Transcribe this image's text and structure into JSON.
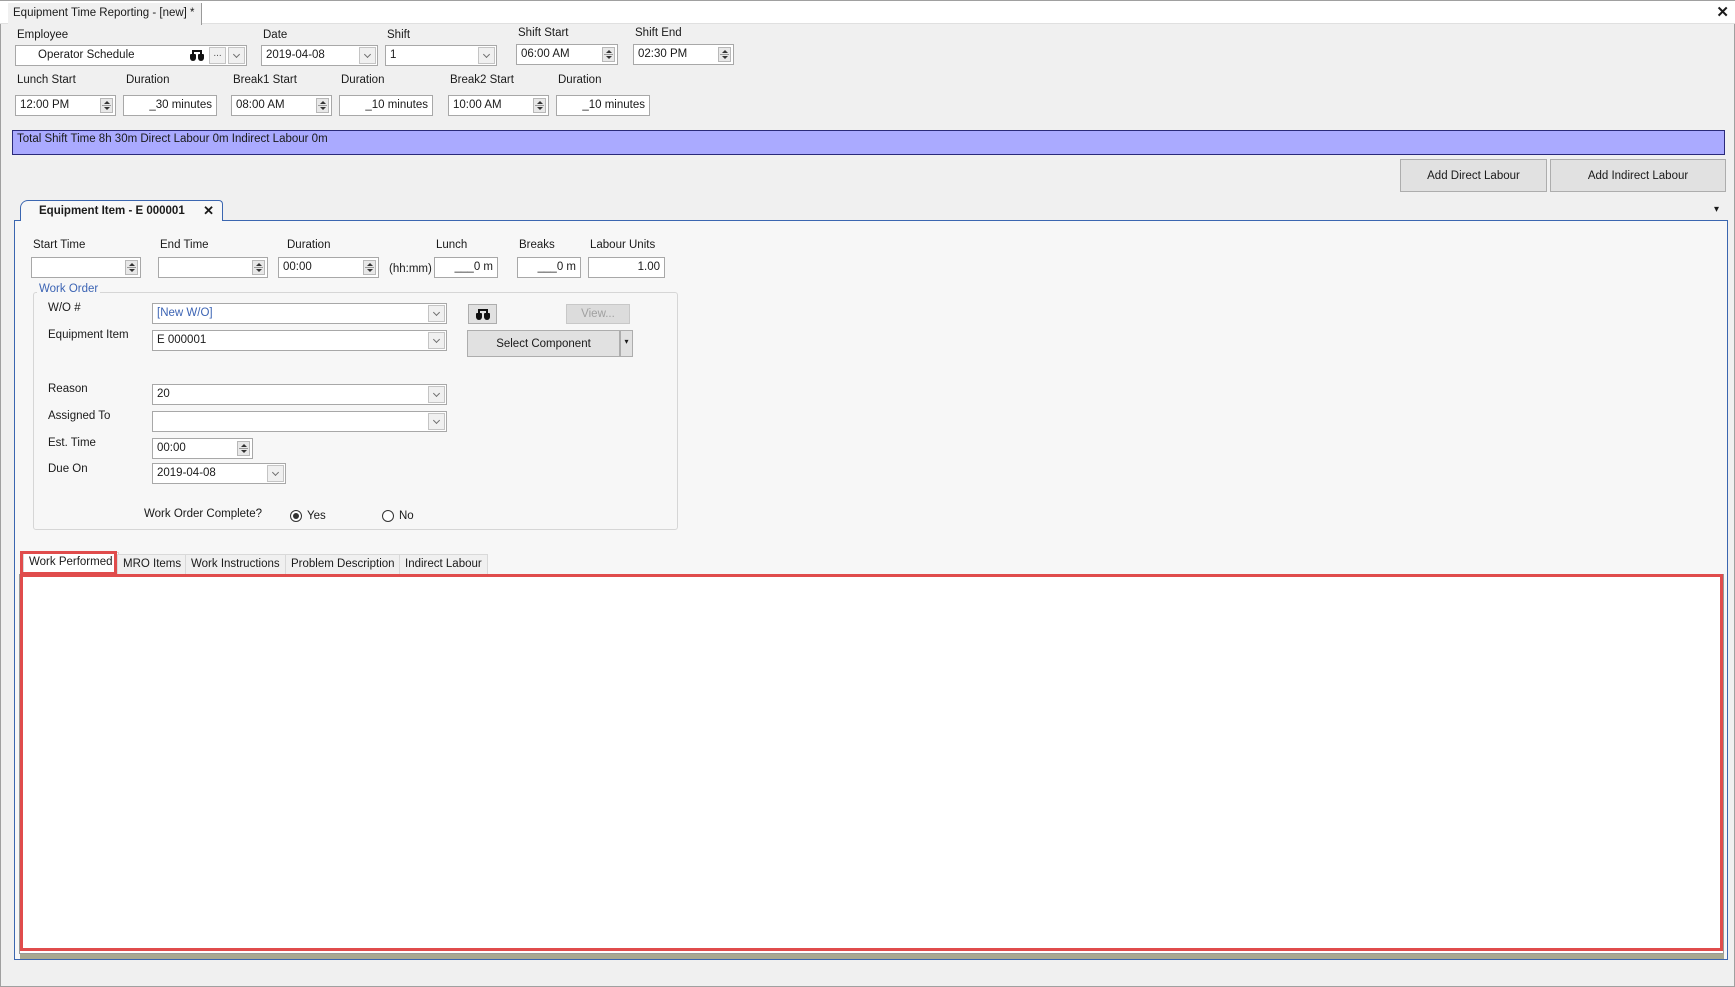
{
  "window": {
    "doc_tab_title": "Equipment Time Reporting - [new] *",
    "close_glyph": "✕"
  },
  "header": {
    "employee": {
      "label": "Employee",
      "value": "Operator Schedule",
      "search_icon": "binoculars-icon",
      "ellipsis": "..."
    },
    "date": {
      "label": "Date",
      "value": "2019-04-08"
    },
    "shift": {
      "label": "Shift",
      "value": "1"
    },
    "shift_start": {
      "label": "Shift Start",
      "value": "06:00 AM"
    },
    "shift_end": {
      "label": "Shift End",
      "value": "02:30 PM"
    },
    "lunch_start": {
      "label": "Lunch Start",
      "value": "12:00 PM"
    },
    "lunch_duration": {
      "label": "Duration",
      "value": "_30 minutes"
    },
    "break1_start": {
      "label": "Break1 Start",
      "value": "08:00 AM"
    },
    "break1_duration": {
      "label": "Duration",
      "value": "_10 minutes"
    },
    "break2_start": {
      "label": "Break2 Start",
      "value": "10:00 AM"
    },
    "break2_duration": {
      "label": "Duration",
      "value": "_10 minutes"
    }
  },
  "summary_bar": {
    "text": "Total Shift Time 8h 30m  Direct Labour 0m  Indirect Labour 0m",
    "color": "#aaaaff"
  },
  "actions": {
    "add_direct_labour": "Add Direct Labour",
    "add_indirect_labour": "Add Indirect Labour"
  },
  "panel": {
    "tab_title": "Equipment Item - E 000001",
    "tab_close": "✕",
    "overflow_glyph": "▾",
    "start_time": {
      "label": "Start Time",
      "value": ""
    },
    "end_time": {
      "label": "End Time",
      "value": ""
    },
    "duration": {
      "label": "Duration",
      "value": "00:00",
      "unit": "(hh:mm)"
    },
    "lunch": {
      "label": "Lunch",
      "value": "___0 m"
    },
    "breaks": {
      "label": "Breaks",
      "value": "___0 m"
    },
    "labour_units": {
      "label": "Labour Units",
      "value": "1.00"
    },
    "work_order": {
      "group_title": "Work Order",
      "wo_number": {
        "label": "W/O #",
        "value": "[New W/O]"
      },
      "equipment_item": {
        "label": "Equipment Item",
        "value": "E 000001"
      },
      "view_button": "View...",
      "select_component_button": "Select Component",
      "reason": {
        "label": "Reason",
        "value": "20"
      },
      "assigned_to": {
        "label": "Assigned To",
        "value": ""
      },
      "est_time": {
        "label": "Est. Time",
        "value": "00:00"
      },
      "due_on": {
        "label": "Due On",
        "value": "2019-04-08"
      },
      "complete": {
        "label": "Work Order Complete?",
        "options": [
          "Yes",
          "No"
        ],
        "selected": "Yes"
      }
    },
    "sub_tabs": [
      {
        "label": "Work Performed",
        "active": true
      },
      {
        "label": "MRO Items",
        "active": false
      },
      {
        "label": "Work Instructions",
        "active": false
      },
      {
        "label": "Problem Description",
        "active": false
      },
      {
        "label": "Indirect Labour",
        "active": false
      }
    ],
    "work_performed_text": ""
  },
  "annotation": {
    "highlight_color": "#e04c4c"
  }
}
